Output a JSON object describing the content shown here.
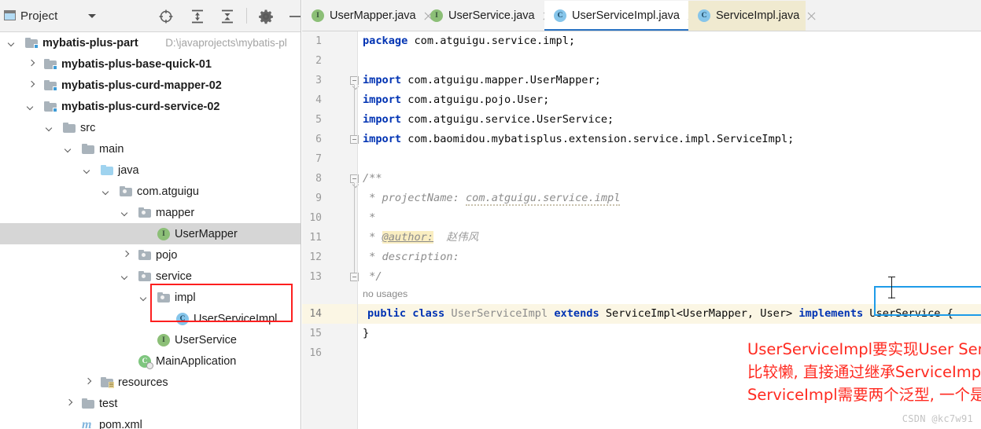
{
  "panel": {
    "title": "Project",
    "window_icon": "project-window-icon",
    "dropdown_icon": "chevron-down-icon",
    "toolbar_icons": [
      {
        "name": "locate-target-icon",
        "label": "Select Opened File"
      },
      {
        "name": "expand-all-icon",
        "label": "Expand All"
      },
      {
        "name": "collapse-all-icon",
        "label": "Collapse All"
      },
      {
        "name": "gear-icon",
        "label": "Settings"
      },
      {
        "name": "minimize-icon",
        "label": "Hide"
      }
    ]
  },
  "tree": {
    "items": [
      {
        "label": "mybatis-plus-part",
        "path": "D:\\javaprojects\\mybatis-pl",
        "indent": 0,
        "twist": "open",
        "icon": "module-folder-icon",
        "bold": true,
        "selected": false
      },
      {
        "label": "mybatis-plus-base-quick-01",
        "path": "",
        "indent": 1,
        "twist": "closed",
        "icon": "module-folder-icon",
        "bold": true,
        "selected": false
      },
      {
        "label": "mybatis-plus-curd-mapper-02",
        "path": "",
        "indent": 1,
        "twist": "closed",
        "icon": "module-folder-icon",
        "bold": true,
        "selected": false
      },
      {
        "label": "mybatis-plus-curd-service-02",
        "path": "",
        "indent": 1,
        "twist": "open",
        "icon": "module-folder-icon",
        "bold": true,
        "selected": false
      },
      {
        "label": "src",
        "path": "",
        "indent": 2,
        "twist": "open",
        "icon": "folder-icon",
        "bold": false,
        "selected": false
      },
      {
        "label": "main",
        "path": "",
        "indent": 3,
        "twist": "open",
        "icon": "folder-icon",
        "bold": false,
        "selected": false
      },
      {
        "label": "java",
        "path": "",
        "indent": 4,
        "twist": "open",
        "icon": "source-root-folder-icon",
        "bold": false,
        "selected": false
      },
      {
        "label": "com.atguigu",
        "path": "",
        "indent": 5,
        "twist": "open",
        "icon": "package-icon",
        "bold": false,
        "selected": false
      },
      {
        "label": "mapper",
        "path": "",
        "indent": 6,
        "twist": "open",
        "icon": "package-icon",
        "bold": false,
        "selected": false
      },
      {
        "label": "UserMapper",
        "path": "",
        "indent": 7,
        "twist": "none",
        "icon": "interface-icon",
        "bold": false,
        "selected": true
      },
      {
        "label": "pojo",
        "path": "",
        "indent": 6,
        "twist": "closed",
        "icon": "package-icon",
        "bold": false,
        "selected": false
      },
      {
        "label": "service",
        "path": "",
        "indent": 6,
        "twist": "open",
        "icon": "package-icon",
        "bold": false,
        "selected": false
      },
      {
        "label": "impl",
        "path": "",
        "indent": 7,
        "twist": "open",
        "icon": "package-icon",
        "bold": false,
        "selected": false
      },
      {
        "label": "UserServiceImpl",
        "path": "",
        "indent": 8,
        "twist": "none",
        "icon": "class-icon",
        "bold": false,
        "selected": false
      },
      {
        "label": "UserService",
        "path": "",
        "indent": 7,
        "twist": "none",
        "icon": "interface-icon",
        "bold": false,
        "selected": false
      },
      {
        "label": "MainApplication",
        "path": "",
        "indent": 6,
        "twist": "none",
        "icon": "spring-boot-class-icon",
        "bold": false,
        "selected": false
      },
      {
        "label": "resources",
        "path": "",
        "indent": 4,
        "twist": "closed",
        "icon": "resources-folder-icon",
        "bold": false,
        "selected": false
      },
      {
        "label": "test",
        "path": "",
        "indent": 3,
        "twist": "closed",
        "icon": "folder-icon",
        "bold": false,
        "selected": false
      },
      {
        "label": "pom.xml",
        "path": "",
        "indent": 3,
        "twist": "none",
        "icon": "maven-icon",
        "bold": false,
        "selected": false
      }
    ]
  },
  "tabs": [
    {
      "label": "UserMapper.java",
      "icon": "interface-icon",
      "state": "normal"
    },
    {
      "label": "UserService.java",
      "icon": "interface-icon",
      "state": "normal"
    },
    {
      "label": "UserServiceImpl.java",
      "icon": "class-icon",
      "state": "active"
    },
    {
      "label": "ServiceImpl.java",
      "icon": "class-icon",
      "state": "modified"
    }
  ],
  "gutter": {
    "line_numbers": [
      "1",
      "2",
      "3",
      "4",
      "5",
      "6",
      "7",
      "8",
      "9",
      "10",
      "11",
      "12",
      "13",
      "14",
      "15",
      "16"
    ],
    "current_line": "14"
  },
  "code": {
    "inlay_hint": "no usages",
    "lines": {
      "l1_kw": "package",
      "l1_rest": " com.atguigu.service.impl;",
      "l3_kw": "import",
      "l3_rest": " com.atguigu.mapper.UserMapper;",
      "l4_kw": "import",
      "l4_rest": " com.atguigu.pojo.User;",
      "l5_kw": "import",
      "l5_rest": " com.atguigu.service.UserService;",
      "l6_kw": "import",
      "l6_rest": " com.baomidou.mybatisplus.extension.service.impl.ServiceImpl;",
      "l8": "/**",
      "l9": " * projectName: ",
      "l9_sq": "com.atguigu.service.impl",
      "l10": " *",
      "l11_pre": " * ",
      "l11_tag": "@author:",
      "l11_name": "赵伟风",
      "l12": " * description:",
      "l13": " */",
      "l14_kw1": "public",
      "l14_kw2": "class",
      "l14_cls": "UserServiceImpl",
      "l14_kw3": "extends",
      "l14_super": "ServiceImpl<UserMapper, User>",
      "l14_kw4": "implements",
      "l14_iface": "UserService",
      "l14_brace": "{",
      "l15": "}"
    }
  },
  "annotation": {
    "line1": "UserServiceImpl要实现User Service接口的所有方法,",
    "line2": "比较懒, 直接通过继承ServiceImpl来补上这些方法的实现",
    "line3": "ServiceImpl需要两个泛型, 一个是mapper一个是实体类",
    "color": "#ff2a20"
  },
  "highlights": {
    "tree_box_color": "#fd1f1f",
    "code_extends_box_color": "#1e9be8",
    "code_implements_box_color": "#fd1f1f"
  },
  "watermark": "CSDN @kc7w91"
}
